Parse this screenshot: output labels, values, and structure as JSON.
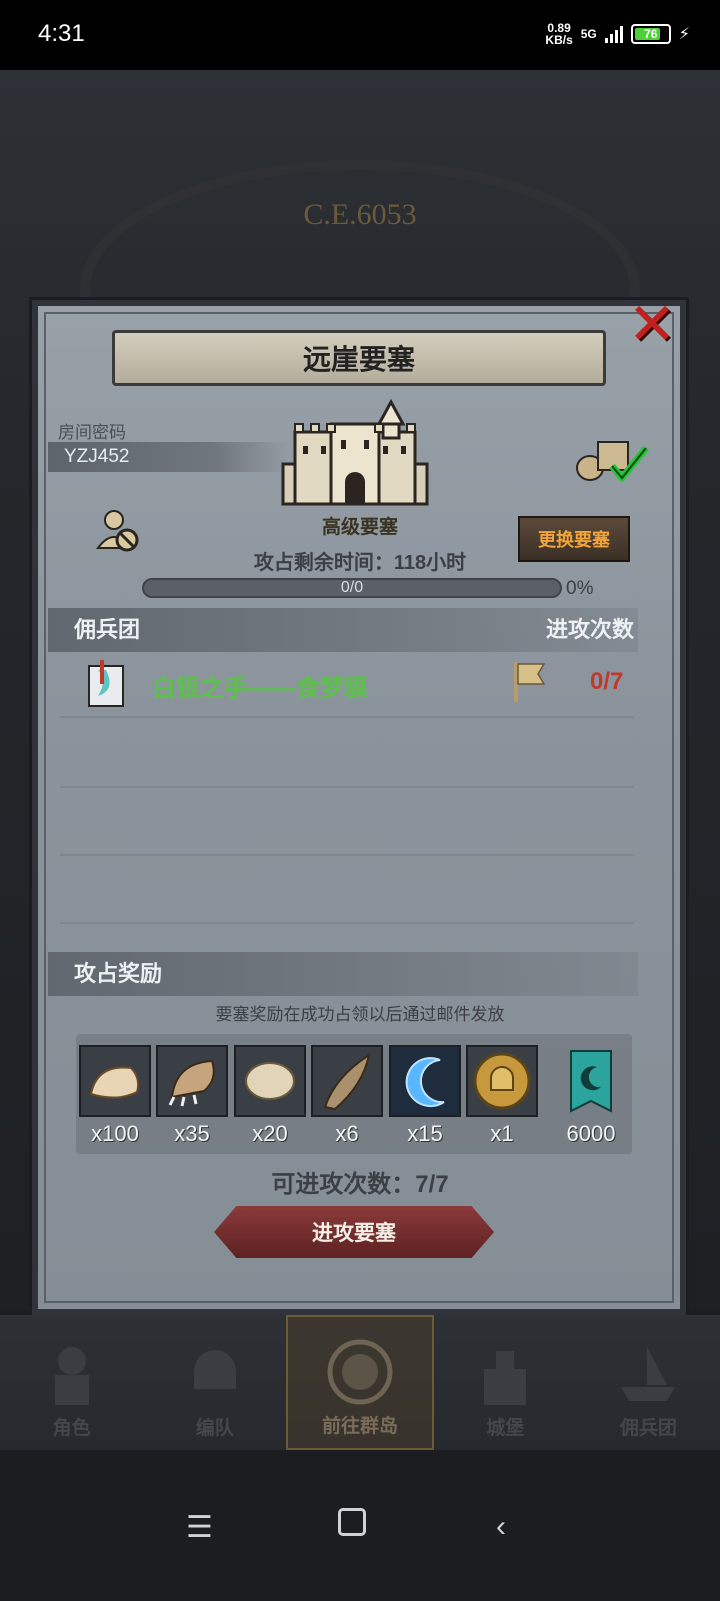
{
  "status": {
    "time": "4:31",
    "net_speed": "0.89",
    "net_unit": "KB/s",
    "network": "5G",
    "battery": "76"
  },
  "backdrop": {
    "era": "C.E.6053"
  },
  "dialog": {
    "title": "远崖要塞",
    "room_code_label": "房间密码",
    "room_code": "YZJ452",
    "fortress_type": "高级要塞",
    "change_button": "更换要塞",
    "time_left": "攻占剩余时间：118小时",
    "progress_text": "0/0",
    "progress_pct": "0%",
    "progress_fraction": 0,
    "mercenary_header": "佣兵团",
    "attack_count_header": "进攻次数",
    "teams": [
      {
        "name": "白银之手——食梦貘",
        "count": "0/7"
      }
    ],
    "reward_header": "攻占奖励",
    "reward_note": "要塞奖励在成功占领以后通过邮件发放",
    "rewards": [
      {
        "icon": "fur-pelt-icon",
        "qty": "x100"
      },
      {
        "icon": "claw-icon",
        "qty": "x35"
      },
      {
        "icon": "hide-icon",
        "qty": "x20"
      },
      {
        "icon": "horn-icon",
        "qty": "x6"
      },
      {
        "icon": "blue-crescent-icon",
        "qty": "x15"
      },
      {
        "icon": "gold-helmet-coin-icon",
        "qty": "x1"
      },
      {
        "icon": "guild-banner-icon",
        "qty": "6000"
      }
    ],
    "attempts": "可进攻次数：7/7",
    "attack_button": "进攻要塞"
  },
  "bottom_nav": [
    {
      "label": "角色",
      "icon": "knight-icon"
    },
    {
      "label": "编队",
      "icon": "helmet-icon"
    },
    {
      "label": "前往群岛",
      "icon": "compass-icon",
      "active": true
    },
    {
      "label": "城堡",
      "icon": "castle-icon"
    },
    {
      "label": "佣兵团",
      "icon": "ship-icon"
    }
  ],
  "colors": {
    "green": "#5ec04c",
    "red": "#c0392b",
    "gold": "#f0a43a",
    "close_red": "#c0201e"
  }
}
